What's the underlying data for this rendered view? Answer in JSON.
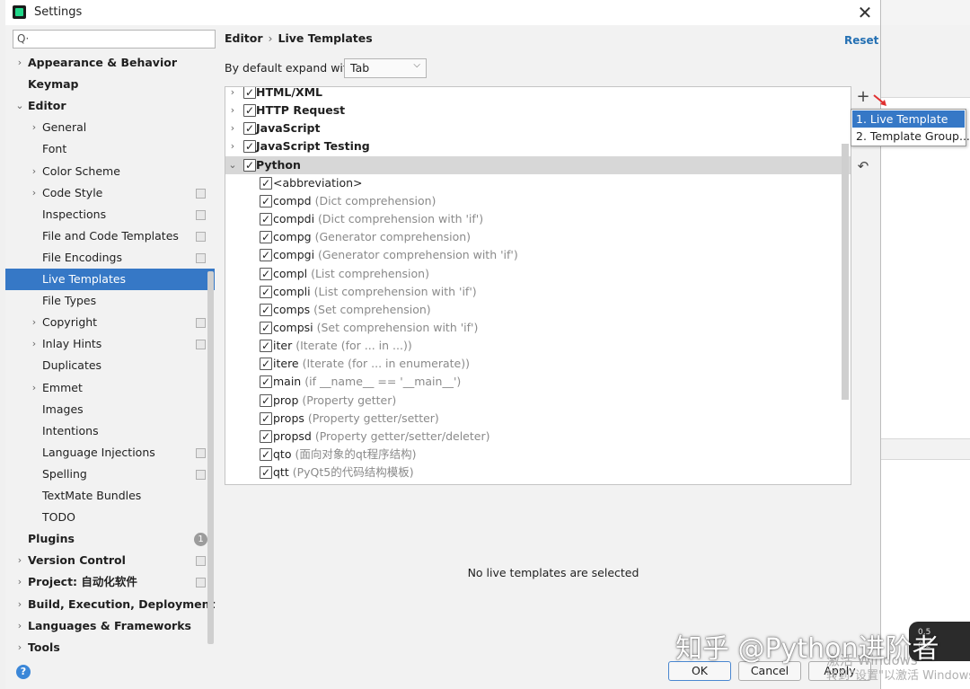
{
  "window": {
    "title": "Settings",
    "close_icon": "close-icon"
  },
  "search": {
    "placeholder": "Q"
  },
  "sidebar": {
    "items": [
      {
        "label": "Appearance & Behavior",
        "level": 0,
        "arrow": "›",
        "bold": true
      },
      {
        "label": "Keymap",
        "level": 0,
        "arrow": "",
        "bold": true
      },
      {
        "label": "Editor",
        "level": 0,
        "arrow": "⌄",
        "bold": true
      },
      {
        "label": "General",
        "level": 1,
        "arrow": "›"
      },
      {
        "label": "Font",
        "level": 1,
        "arrow": ""
      },
      {
        "label": "Color Scheme",
        "level": 1,
        "arrow": "›"
      },
      {
        "label": "Code Style",
        "level": 1,
        "arrow": "›",
        "project": true
      },
      {
        "label": "Inspections",
        "level": 1,
        "arrow": "",
        "project": true
      },
      {
        "label": "File and Code Templates",
        "level": 1,
        "arrow": "",
        "project": true
      },
      {
        "label": "File Encodings",
        "level": 1,
        "arrow": "",
        "project": true
      },
      {
        "label": "Live Templates",
        "level": 1,
        "arrow": "",
        "selected": true
      },
      {
        "label": "File Types",
        "level": 1,
        "arrow": ""
      },
      {
        "label": "Copyright",
        "level": 1,
        "arrow": "›",
        "project": true
      },
      {
        "label": "Inlay Hints",
        "level": 1,
        "arrow": "›",
        "project": true
      },
      {
        "label": "Duplicates",
        "level": 1,
        "arrow": ""
      },
      {
        "label": "Emmet",
        "level": 1,
        "arrow": "›"
      },
      {
        "label": "Images",
        "level": 1,
        "arrow": ""
      },
      {
        "label": "Intentions",
        "level": 1,
        "arrow": ""
      },
      {
        "label": "Language Injections",
        "level": 1,
        "arrow": "",
        "project": true
      },
      {
        "label": "Spelling",
        "level": 1,
        "arrow": "",
        "project": true
      },
      {
        "label": "TextMate Bundles",
        "level": 1,
        "arrow": ""
      },
      {
        "label": "TODO",
        "level": 1,
        "arrow": ""
      },
      {
        "label": "Plugins",
        "level": 0,
        "arrow": "",
        "bold": true,
        "badge": "1"
      },
      {
        "label": "Version Control",
        "level": 0,
        "arrow": "›",
        "bold": true,
        "project": true
      },
      {
        "label": "Project: 自动化软件",
        "level": 0,
        "arrow": "›",
        "bold": true,
        "project": true
      },
      {
        "label": "Build, Execution, Deployment",
        "level": 0,
        "arrow": "›",
        "bold": true
      },
      {
        "label": "Languages & Frameworks",
        "level": 0,
        "arrow": "›",
        "bold": true
      },
      {
        "label": "Tools",
        "level": 0,
        "arrow": "›",
        "bold": true
      }
    ],
    "help_label": "?"
  },
  "header": {
    "breadcrumb_parent": "Editor",
    "breadcrumb_sep": "›",
    "breadcrumb_current": "Live Templates",
    "reset_label": "Reset"
  },
  "expand": {
    "label": "By default expand with",
    "value": "Tab"
  },
  "templates": {
    "groups": [
      {
        "name": "HTML/XML",
        "expanded": false
      },
      {
        "name": "HTTP Request",
        "expanded": false
      },
      {
        "name": "JavaScript",
        "expanded": false
      },
      {
        "name": "JavaScript Testing",
        "expanded": false
      },
      {
        "name": "Python",
        "expanded": true,
        "highlighted": true
      }
    ],
    "python_items": [
      {
        "abbr": "<abbreviation>",
        "desc": ""
      },
      {
        "abbr": "compd",
        "desc": "(Dict comprehension)"
      },
      {
        "abbr": "compdi",
        "desc": "(Dict comprehension with 'if')"
      },
      {
        "abbr": "compg",
        "desc": "(Generator comprehension)"
      },
      {
        "abbr": "compgi",
        "desc": "(Generator comprehension with 'if')"
      },
      {
        "abbr": "compl",
        "desc": "(List comprehension)"
      },
      {
        "abbr": "compli",
        "desc": "(List comprehension with 'if')"
      },
      {
        "abbr": "comps",
        "desc": "(Set comprehension)"
      },
      {
        "abbr": "compsi",
        "desc": "(Set comprehension with 'if')"
      },
      {
        "abbr": "iter",
        "desc": "(Iterate (for ... in ...))"
      },
      {
        "abbr": "itere",
        "desc": "(Iterate (for ... in enumerate))"
      },
      {
        "abbr": "main",
        "desc": "(if __name__ == '__main__')"
      },
      {
        "abbr": "prop",
        "desc": "(Property getter)"
      },
      {
        "abbr": "props",
        "desc": "(Property getter/setter)"
      },
      {
        "abbr": "propsd",
        "desc": "(Property getter/setter/deleter)"
      },
      {
        "abbr": "qto",
        "desc": "(面向对象的qt程序结构)"
      },
      {
        "abbr": "qtt",
        "desc": "(PyQt5的代码结构模板)"
      }
    ],
    "empty_message": "No live templates are selected"
  },
  "toolbar": {
    "add_label": "+",
    "undo_label": "↶"
  },
  "add_popup": {
    "items": [
      "1. Live Template",
      "2. Template Group..."
    ]
  },
  "buttons": {
    "ok": "OK",
    "cancel": "Cancel",
    "apply": "Apply"
  },
  "overlay": {
    "watermark": "知乎 @Python进阶者",
    "activate_line1": "激活 Windows",
    "activate_line2": "转到\"设置\"以激活 Windows",
    "perf_up": "0.5",
    "perf_down": "0.2"
  },
  "colors": {
    "selection": "#3678c6",
    "link": "#2470b3",
    "arrow_red": "#e03030"
  }
}
